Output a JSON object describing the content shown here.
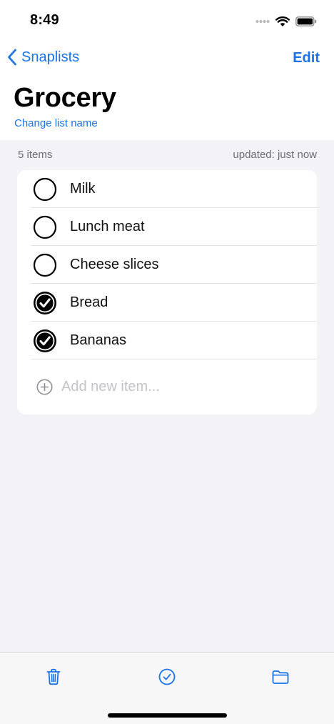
{
  "status_bar": {
    "time": "8:49"
  },
  "nav": {
    "back_label": "Snaplists",
    "edit_label": "Edit"
  },
  "header": {
    "title": "Grocery",
    "change_name_label": "Change list name"
  },
  "meta": {
    "item_count": "5 items",
    "updated": "updated: just now"
  },
  "items": [
    {
      "label": "Milk",
      "checked": false
    },
    {
      "label": "Lunch meat",
      "checked": false
    },
    {
      "label": "Cheese slices",
      "checked": false
    },
    {
      "label": "Bread",
      "checked": true
    },
    {
      "label": "Bananas",
      "checked": true
    }
  ],
  "add_item": {
    "placeholder": "Add new item..."
  },
  "toolbar": {
    "icons": [
      "trash-icon",
      "checkmark-circle-icon",
      "folder-icon"
    ]
  },
  "colors": {
    "accent": "#1a73e8",
    "background": "#f2f2f7",
    "card": "#ffffff",
    "meta_text": "#6d6d72"
  }
}
